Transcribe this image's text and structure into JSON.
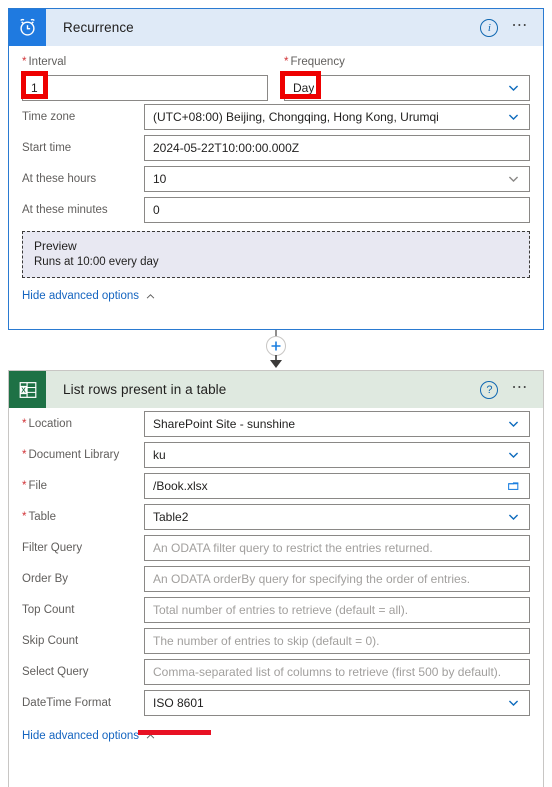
{
  "recurrence_card": {
    "icon": "alarm-clock-icon",
    "title": "Recurrence",
    "info_icon": "info-icon",
    "menu_icon": "ellipsis-icon",
    "interval": {
      "label": "Interval",
      "required": true,
      "value": "1"
    },
    "frequency": {
      "label": "Frequency",
      "required": true,
      "value": "Day",
      "chevron": "chevron-down-icon"
    },
    "fields": [
      {
        "label": "Time zone",
        "value": "(UTC+08:00) Beijing, Chongqing, Hong Kong, Urumqi",
        "chevron": "blue",
        "placeholder": ""
      },
      {
        "label": "Start time",
        "value": "2024-05-22T10:00:00.000Z",
        "chevron": "none",
        "placeholder": ""
      },
      {
        "label": "At these hours",
        "value": "10",
        "chevron": "gray",
        "placeholder": ""
      },
      {
        "label": "At these minutes",
        "value": "0",
        "chevron": "none",
        "placeholder": ""
      }
    ],
    "preview": {
      "title": "Preview",
      "text": "Runs at 10:00 every day"
    },
    "advanced_link": "Hide advanced options"
  },
  "excel_card": {
    "icon": "excel-icon",
    "title": "List rows present in a table",
    "help_icon": "help-icon",
    "menu_icon": "ellipsis-icon",
    "fields": [
      {
        "label": "Location",
        "required": true,
        "value": "SharePoint Site - sunshine",
        "placeholder": "",
        "trailing": "chevron-down-icon"
      },
      {
        "label": "Document Library",
        "required": true,
        "value": "ku",
        "placeholder": "",
        "trailing": "chevron-down-icon"
      },
      {
        "label": "File",
        "required": true,
        "value": "/Book.xlsx",
        "placeholder": "",
        "trailing": "folder-icon"
      },
      {
        "label": "Table",
        "required": true,
        "value": "Table2",
        "placeholder": "",
        "trailing": "chevron-down-icon"
      },
      {
        "label": "Filter Query",
        "required": false,
        "value": "",
        "placeholder": "An ODATA filter query to restrict the entries returned.",
        "trailing": "none"
      },
      {
        "label": "Order By",
        "required": false,
        "value": "",
        "placeholder": "An ODATA orderBy query for specifying the order of entries.",
        "trailing": "none"
      },
      {
        "label": "Top Count",
        "required": false,
        "value": "",
        "placeholder": "Total number of entries to retrieve (default = all).",
        "trailing": "none"
      },
      {
        "label": "Skip Count",
        "required": false,
        "value": "",
        "placeholder": "The number of entries to skip (default = 0).",
        "trailing": "none"
      },
      {
        "label": "Select Query",
        "required": false,
        "value": "",
        "placeholder": "Comma-separated list of columns to retrieve (first 500 by default).",
        "trailing": "none"
      },
      {
        "label": "DateTime Format",
        "required": false,
        "value": "ISO 8601",
        "placeholder": "",
        "trailing": "chevron-down-icon"
      }
    ],
    "advanced_link": "Hide advanced options"
  },
  "connector": {
    "add_button": "add-step-button",
    "symbol": "+"
  },
  "annotations": {
    "highlight_interval": "1",
    "highlight_frequency": "Day",
    "underline_datetime_format": "ISO 8601",
    "color": "#ee0000"
  }
}
